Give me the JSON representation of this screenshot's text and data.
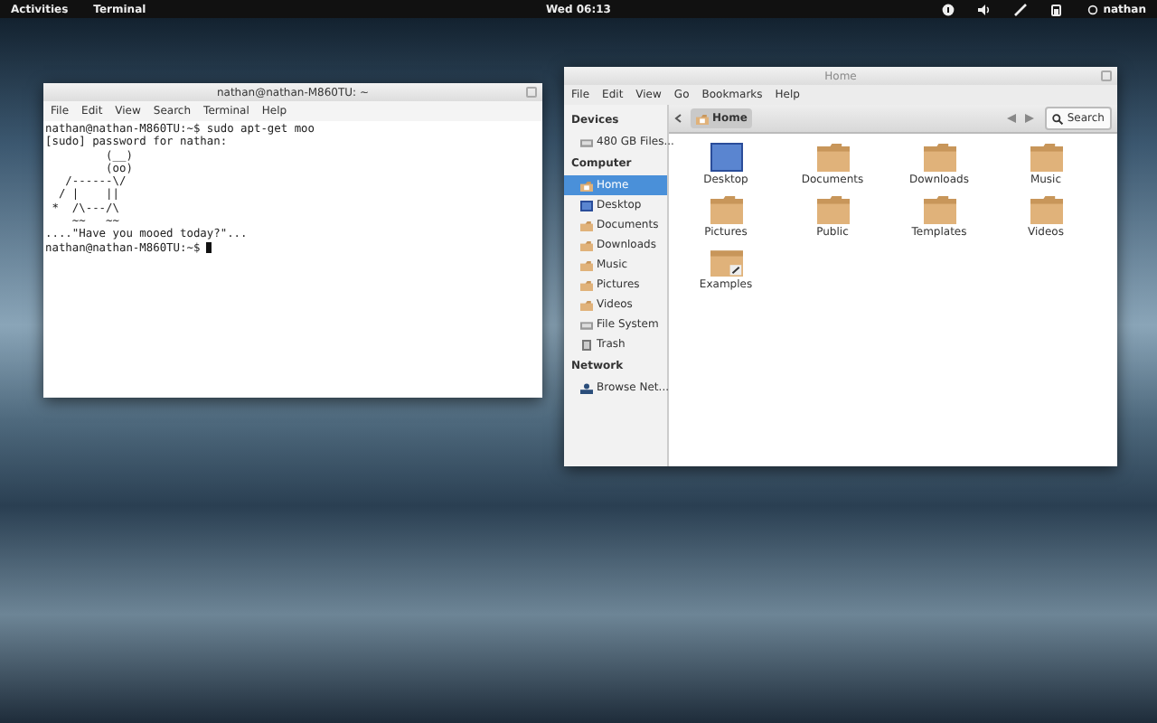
{
  "top_bar": {
    "activities": "Activities",
    "app_menu": "Terminal",
    "clock": "Wed 06:13",
    "user": "nathan"
  },
  "terminal": {
    "title": "nathan@nathan-M860TU: ~",
    "menu": [
      "File",
      "Edit",
      "View",
      "Search",
      "Terminal",
      "Help"
    ],
    "lines": [
      "nathan@nathan-M860TU:~$ sudo apt-get moo",
      "[sudo] password for nathan:",
      "         (__)",
      "         (oo)",
      "   /------\\/",
      "  / |    ||",
      " *  /\\---/\\",
      "    ~~   ~~",
      "....\"Have you mooed today?\"...",
      "nathan@nathan-M860TU:~$ "
    ]
  },
  "file_manager": {
    "title": "Home",
    "menu": [
      "File",
      "Edit",
      "View",
      "Go",
      "Bookmarks",
      "Help"
    ],
    "sidebar": [
      {
        "heading": "Devices",
        "items": [
          {
            "label": "480 GB Files...",
            "kind": "drive",
            "selected": false
          }
        ]
      },
      {
        "heading": "Computer",
        "items": [
          {
            "label": "Home",
            "kind": "home",
            "selected": true
          },
          {
            "label": "Desktop",
            "kind": "desktop",
            "selected": false
          },
          {
            "label": "Documents",
            "kind": "folder",
            "selected": false
          },
          {
            "label": "Downloads",
            "kind": "folder",
            "selected": false
          },
          {
            "label": "Music",
            "kind": "folder",
            "selected": false
          },
          {
            "label": "Pictures",
            "kind": "folder",
            "selected": false
          },
          {
            "label": "Videos",
            "kind": "folder",
            "selected": false
          },
          {
            "label": "File System",
            "kind": "drive",
            "selected": false
          },
          {
            "label": "Trash",
            "kind": "trash",
            "selected": false
          }
        ]
      },
      {
        "heading": "Network",
        "items": [
          {
            "label": "Browse Net...",
            "kind": "network",
            "selected": false
          }
        ]
      }
    ],
    "path": "Home",
    "search": "Search",
    "files": [
      {
        "label": "Desktop",
        "kind": "desktop"
      },
      {
        "label": "Documents",
        "kind": "folder"
      },
      {
        "label": "Downloads",
        "kind": "folder"
      },
      {
        "label": "Music",
        "kind": "folder"
      },
      {
        "label": "Pictures",
        "kind": "folder"
      },
      {
        "label": "Public",
        "kind": "folder"
      },
      {
        "label": "Templates",
        "kind": "folder"
      },
      {
        "label": "Videos",
        "kind": "folder"
      },
      {
        "label": "Examples",
        "kind": "link"
      }
    ]
  }
}
